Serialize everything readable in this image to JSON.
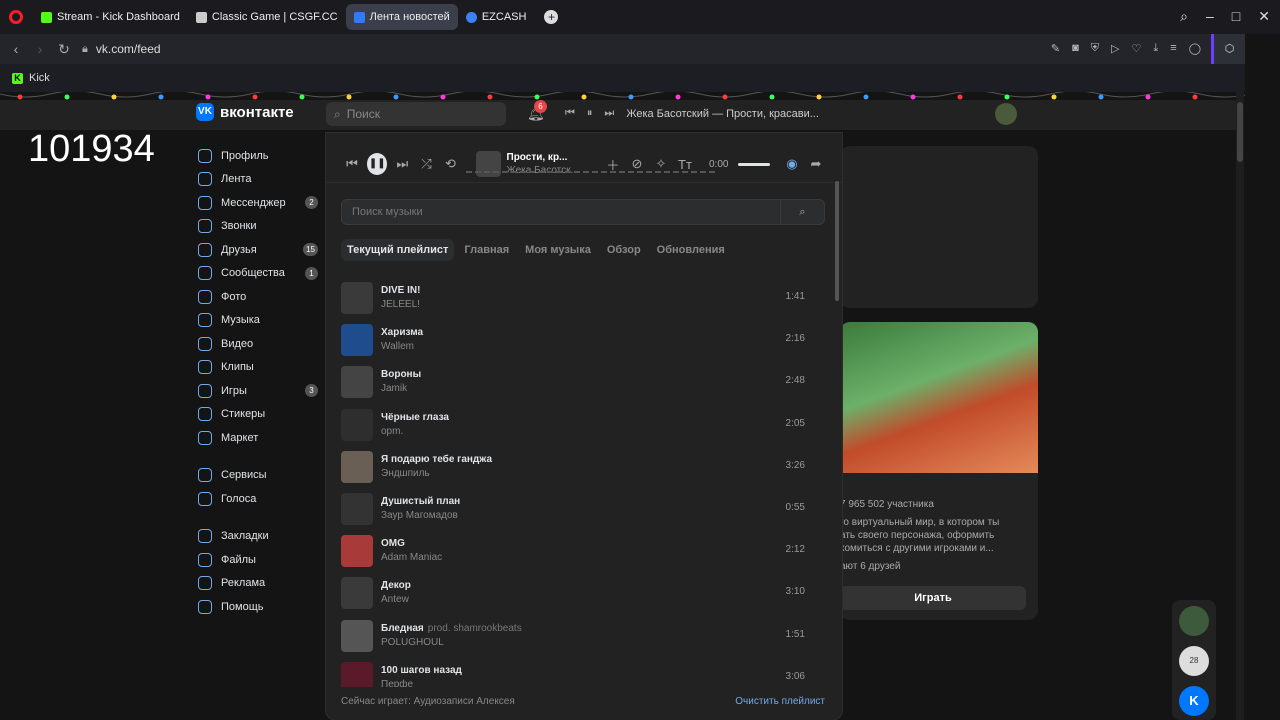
{
  "browser": {
    "tabs": [
      {
        "label": "Stream - Kick Dashboard",
        "color": "#53fc18"
      },
      {
        "label": "Classic Game | CSGF.CC",
        "color": "#cccccc"
      },
      {
        "label": "Лента новостей",
        "color": "#2f7cf6"
      },
      {
        "label": "EZCASH",
        "color": "#3b82f6"
      }
    ],
    "url": "vk.com/feed",
    "bookmark": "Kick"
  },
  "overlay_number": "101934",
  "header": {
    "logo": "вконтакте",
    "search_placeholder": "Поиск",
    "bell_badge": "6",
    "now_playing": "Жека Басотский — Прости, красави..."
  },
  "sidebar": {
    "items": [
      {
        "label": "Профиль",
        "count": ""
      },
      {
        "label": "Лента",
        "count": ""
      },
      {
        "label": "Мессенджер",
        "count": "2"
      },
      {
        "label": "Звонки",
        "count": ""
      },
      {
        "label": "Друзья",
        "count": "15"
      },
      {
        "label": "Сообщества",
        "count": "1"
      },
      {
        "label": "Фото",
        "count": ""
      },
      {
        "label": "Музыка",
        "count": ""
      },
      {
        "label": "Видео",
        "count": ""
      },
      {
        "label": "Клипы",
        "count": ""
      },
      {
        "label": "Игры",
        "count": "3"
      },
      {
        "label": "Стикеры",
        "count": ""
      },
      {
        "label": "Маркет",
        "count": ""
      }
    ],
    "items2": [
      {
        "label": "Сервисы"
      },
      {
        "label": "Голоса"
      }
    ],
    "items3": [
      {
        "label": "Закладки"
      },
      {
        "label": "Файлы"
      },
      {
        "label": "Реклама"
      },
      {
        "label": "Помощь"
      }
    ]
  },
  "player": {
    "track_title": "Прости, кр...",
    "track_artist": "Жека Басотск...",
    "time": "0:00",
    "search_placeholder": "Поиск музыки",
    "tabs": [
      "Текущий плейлист",
      "Главная",
      "Моя музыка",
      "Обзор",
      "Обновления"
    ],
    "tracks": [
      {
        "title": "DIVE IN!",
        "subtitle": "",
        "artist": "JELEEL!",
        "duration": "1:41",
        "color": "#3a3a3a"
      },
      {
        "title": "Харизма",
        "subtitle": "",
        "artist": "Wallem",
        "duration": "2:16",
        "color": "#1f4c8c"
      },
      {
        "title": "Вороны",
        "subtitle": "",
        "artist": "Jamik",
        "duration": "2:48",
        "color": "#444444"
      },
      {
        "title": "Чёрные глаза",
        "subtitle": "",
        "artist": "орm.",
        "duration": "2:05",
        "color": "#2e2e2e"
      },
      {
        "title": "Я подарю тебе ганджа",
        "subtitle": "",
        "artist": "Эндшпиль",
        "duration": "3:26",
        "color": "#6a5f55"
      },
      {
        "title": "Душистый план",
        "subtitle": "",
        "artist": "Заур Магомадов",
        "duration": "0:55",
        "color": "#333333"
      },
      {
        "title": "OMG",
        "subtitle": "",
        "artist": "Adam Maniac",
        "duration": "2:12",
        "color": "#a83a3a"
      },
      {
        "title": "Декор",
        "subtitle": "",
        "artist": "Antew",
        "duration": "3:10",
        "color": "#3a3a3a"
      },
      {
        "title": "Бледная",
        "subtitle": "prod. shamrookbeats",
        "artist": "POLUGHOUL",
        "duration": "1:51",
        "color": "#555555"
      },
      {
        "title": "100 шагов назад",
        "subtitle": "",
        "artist": "Перфе",
        "duration": "3:06",
        "color": "#5a1a2a"
      }
    ],
    "footer": "Сейчас играет: Аудиозаписи Алексея",
    "clear": "Очистить плейлист"
  },
  "feed": {
    "members": "7 965 502 участника",
    "desc": "го виртуальный мир, в котором ты ать своего персонажа, оформить комиться с другими игроками и...",
    "friends": "ают 6 друзей",
    "play_btn": "Играть"
  },
  "rail_badge": "28",
  "rail_badge2": "2"
}
